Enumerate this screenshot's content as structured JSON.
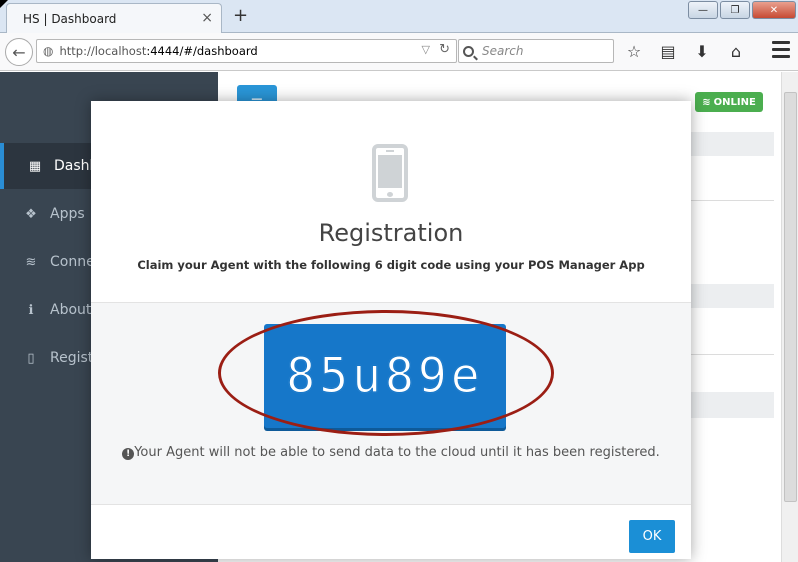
{
  "browser": {
    "tab_title": "HS | Dashboard",
    "tab_close": "×",
    "new_tab": "+",
    "url_host": "http://localhost",
    "url_rest": ":4444/#/dashboard",
    "search_placeholder": "Search",
    "window_buttons": [
      "—",
      "❐",
      "✕"
    ]
  },
  "sidebar": {
    "items": [
      {
        "label": "Dashboard",
        "icon": "grid-icon",
        "glyph": "▦"
      },
      {
        "label": "Apps",
        "icon": "cubes-icon",
        "glyph": "❖"
      },
      {
        "label": "Connect",
        "icon": "wifi-icon",
        "glyph": "≋"
      },
      {
        "label": "About",
        "icon": "info-icon",
        "glyph": "ℹ"
      },
      {
        "label": "Registration",
        "icon": "mobile-icon",
        "glyph": "▯"
      }
    ]
  },
  "header": {
    "menu_glyph": "≡",
    "status_label": "ONLINE",
    "status_color": "#4bae4f"
  },
  "modal": {
    "title": "Registration",
    "subtitle": "Claim your Agent with the following 6 digit code using your POS Manager App",
    "code": "85u89e",
    "warning": "Your Agent will not be able to send data to the cloud until it has been registered.",
    "ok_label": "OK",
    "accent_color": "#1677c9"
  }
}
